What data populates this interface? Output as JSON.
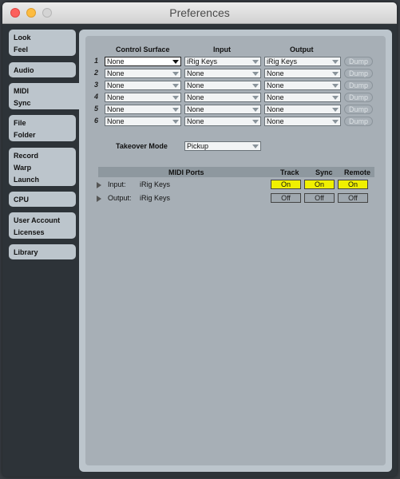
{
  "window": {
    "title": "Preferences"
  },
  "sidebar": {
    "tabs": [
      {
        "lines": [
          "Look",
          "Feel"
        ]
      },
      {
        "lines": [
          "Audio"
        ]
      },
      {
        "lines": [
          "MIDI",
          "Sync"
        ]
      },
      {
        "lines": [
          "File",
          "Folder"
        ]
      },
      {
        "lines": [
          "Record",
          "Warp",
          "Launch"
        ]
      },
      {
        "lines": [
          "CPU"
        ]
      },
      {
        "lines": [
          "User Account",
          "Licenses"
        ]
      },
      {
        "lines": [
          "Library"
        ]
      }
    ]
  },
  "midi": {
    "headers": {
      "control_surface": "Control Surface",
      "input": "Input",
      "output": "Output"
    },
    "rows": [
      {
        "num": "1",
        "surface": "None",
        "input": "iRig Keys",
        "output": "iRig Keys",
        "dump": "Dump"
      },
      {
        "num": "2",
        "surface": "None",
        "input": "None",
        "output": "None",
        "dump": "Dump"
      },
      {
        "num": "3",
        "surface": "None",
        "input": "None",
        "output": "None",
        "dump": "Dump"
      },
      {
        "num": "4",
        "surface": "None",
        "input": "None",
        "output": "None",
        "dump": "Dump"
      },
      {
        "num": "5",
        "surface": "None",
        "input": "None",
        "output": "None",
        "dump": "Dump"
      },
      {
        "num": "6",
        "surface": "None",
        "input": "None",
        "output": "None",
        "dump": "Dump"
      }
    ],
    "takeover": {
      "label": "Takeover Mode",
      "value": "Pickup"
    },
    "ports": {
      "headers": {
        "midi_ports": "MIDI Ports",
        "track": "Track",
        "sync": "Sync",
        "remote": "Remote"
      },
      "items": [
        {
          "dir": "Input:",
          "name": "iRig Keys",
          "track": "On",
          "sync": "On",
          "remote": "On"
        },
        {
          "dir": "Output:",
          "name": "iRig Keys",
          "track": "Off",
          "sync": "Off",
          "remote": "Off"
        }
      ]
    }
  }
}
